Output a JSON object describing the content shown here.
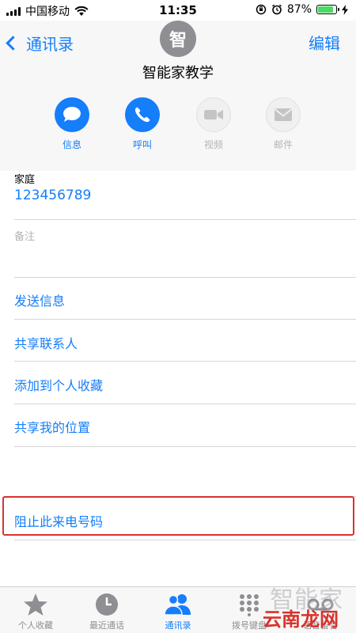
{
  "status_bar": {
    "carrier": "中国移动",
    "time": "11:35",
    "battery_text": "87%",
    "battery_level": 0.87
  },
  "header": {
    "back_label": "通讯录",
    "edit_label": "编辑",
    "avatar_initial": "智",
    "contact_name": "智能家教学"
  },
  "actions": [
    {
      "label": "信息",
      "icon": "message-icon",
      "enabled": true
    },
    {
      "label": "呼叫",
      "icon": "phone-icon",
      "enabled": true
    },
    {
      "label": "视频",
      "icon": "video-icon",
      "enabled": false
    },
    {
      "label": "邮件",
      "icon": "mail-icon",
      "enabled": false
    }
  ],
  "phone_field": {
    "label": "家庭",
    "value": "123456789"
  },
  "notes_field": {
    "label": "备注"
  },
  "links": [
    "发送信息",
    "共享联系人",
    "添加到个人收藏",
    "共享我的位置"
  ],
  "block_link": "阻止此来电号码",
  "tabs": [
    {
      "label": "个人收藏",
      "icon": "star-icon",
      "active": false
    },
    {
      "label": "最近通话",
      "icon": "clock-icon",
      "active": false
    },
    {
      "label": "通讯录",
      "icon": "contacts-icon",
      "active": true
    },
    {
      "label": "拨号键盘",
      "icon": "keypad-icon",
      "active": false
    },
    {
      "label": "语音留言",
      "icon": "voicemail-icon",
      "active": false
    }
  ],
  "watermark": {
    "top": "智能家",
    "bottom": "云南龙网"
  },
  "colors": {
    "accent": "#147efb",
    "highlight": "#d9322c",
    "battery": "#4cd964"
  }
}
